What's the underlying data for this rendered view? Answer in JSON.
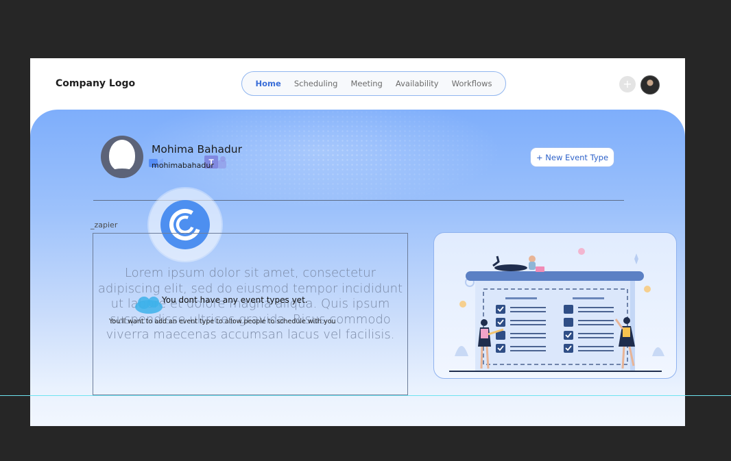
{
  "header": {
    "logo": "Company Logo",
    "tabs": [
      {
        "label": "Home",
        "active": true
      },
      {
        "label": "Scheduling",
        "active": false
      },
      {
        "label": "Meeting",
        "active": false
      },
      {
        "label": "Availability",
        "active": false
      },
      {
        "label": "Workflows",
        "active": false
      }
    ],
    "add_label": "+"
  },
  "profile": {
    "name": "Mohima Bahadur",
    "username": "mohimabahadur"
  },
  "actions": {
    "new_event_label": "+ New Event Type"
  },
  "integrations": {
    "zapier_label": "_zapier"
  },
  "empty_state": {
    "lorem": "Lorem ipsum dolor sit amet, consectetur adipiscing elit, sed do eiusmod tempor incididunt ut labore et dolore magna aliqua. Quis ipsum suspendisse ultrices gravida. Risus commodo viverra maecenas accumsan lacus vel facilisis.",
    "title": "You dont have any event types yet.",
    "subtitle": "You'll want to add an event type to allow people to schedule with you"
  },
  "colors": {
    "accent": "#3a6ed8",
    "hero_top": "#7eaefb",
    "hero_bottom": "#f4f8ff",
    "checkbox": "#2f4e86"
  }
}
